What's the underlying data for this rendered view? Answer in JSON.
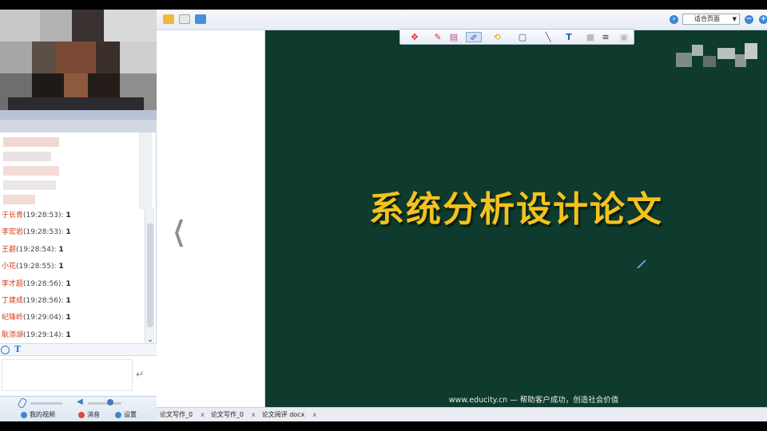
{
  "toolbar": {
    "zoom_mode": "适合页面"
  },
  "chat": {
    "messages": [
      {
        "name": "于长青",
        "time": "(19:28:53):",
        "text": "1"
      },
      {
        "name": "李宏岩",
        "time": "(19:28:53):",
        "text": "1"
      },
      {
        "name": "王碧",
        "time": "(19:28:54):",
        "text": "1"
      },
      {
        "name": "小花",
        "time": "(19:28:55):",
        "text": "1"
      },
      {
        "name": "李才超",
        "time": "(19:28:56):",
        "text": "1"
      },
      {
        "name": "丁建成",
        "time": "(19:28:56):",
        "text": "1"
      },
      {
        "name": "纪锋岭",
        "time": "(19:29:04):",
        "text": "1"
      },
      {
        "name": "耿添湖",
        "time": "(19:29:14):",
        "text": "1"
      }
    ]
  },
  "controls": {
    "my_video": "我的视频",
    "mute": "消音",
    "settings": "设置"
  },
  "slide": {
    "title": "系统分析设计论文",
    "footer": "www.educity.cn  —  帮助客户成功，创造社会价值"
  },
  "tabs": [
    {
      "label": "论文写作_0",
      "close": "x"
    },
    {
      "label": "论文写作_0",
      "close": "x"
    },
    {
      "label": "论文阅评 docx",
      "close": "x"
    }
  ],
  "colors": {
    "slide_bg": "#0e3b2d",
    "title": "#f4c21d",
    "chat_name": "#d23c16",
    "accent": "#3d86d8"
  }
}
